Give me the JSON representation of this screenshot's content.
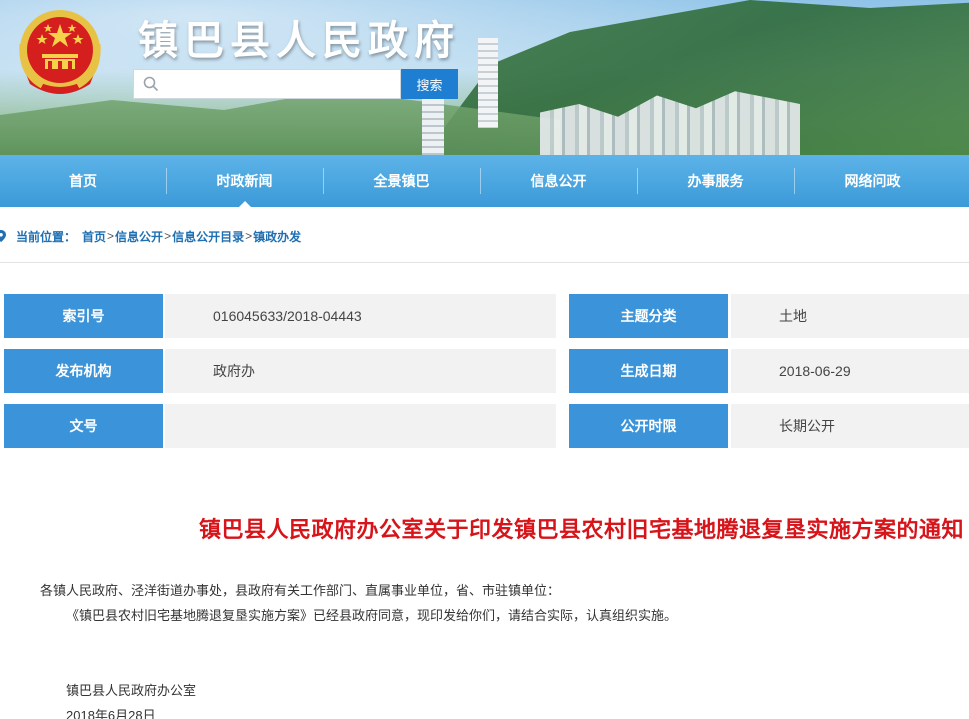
{
  "site": {
    "title": "镇巴县人民政府"
  },
  "search": {
    "placeholder": "",
    "button_label": "搜索"
  },
  "nav": {
    "items": [
      {
        "label": "首页"
      },
      {
        "label": "时政新闻"
      },
      {
        "label": "全景镇巴"
      },
      {
        "label": "信息公开"
      },
      {
        "label": "办事服务"
      },
      {
        "label": "网络问政"
      }
    ],
    "active_index": 1
  },
  "breadcrumb": {
    "label": "当前位置：",
    "items": [
      "首页",
      "信息公开",
      "信息公开目录",
      "镇政办发"
    ],
    "separator": ">"
  },
  "meta": {
    "index_label": "索引号",
    "index_value": "016045633/2018-04443",
    "topic_label": "主题分类",
    "topic_value": "土地",
    "publisher_label": "发布机构",
    "publisher_value": "政府办",
    "date_label": "生成日期",
    "date_value": "2018-06-29",
    "docno_label": "文号",
    "docno_value": "",
    "period_label": "公开时限",
    "period_value": "长期公开"
  },
  "article": {
    "title": "镇巴县人民政府办公室关于印发镇巴县农村旧宅基地腾退复垦实施方案的通知",
    "recipients": "各镇人民政府、泾洋街道办事处，县政府有关工作部门、直属事业单位，省、市驻镇单位：",
    "paragraph": "《镇巴县农村旧宅基地腾退复垦实施方案》已经县政府同意，现印发给你们，请结合实际，认真组织实施。",
    "signature": "镇巴县人民政府办公室",
    "date": "2018年6月28日"
  },
  "colors": {
    "nav_blue": "#3c9ad8",
    "label_blue": "#3b94d9",
    "title_red": "#d7141a",
    "link_blue": "#1f6fb3",
    "button_blue": "#1e7fd2"
  }
}
